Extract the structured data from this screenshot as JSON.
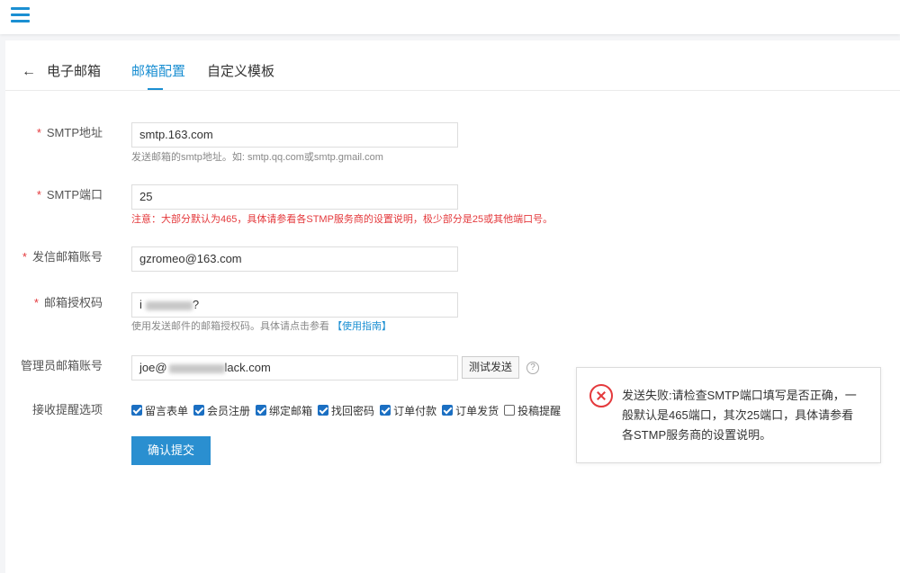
{
  "header": {
    "back_symbol": "←",
    "title": "电子邮箱",
    "tabs": [
      {
        "label": "邮箱配置",
        "active": true
      },
      {
        "label": "自定义模板",
        "active": false
      }
    ]
  },
  "form": {
    "required_mark": "*",
    "smtp_host": {
      "label": "SMTP地址",
      "value": "smtp.163.com",
      "hint": "发送邮箱的smtp地址。如: smtp.qq.com或smtp.gmail.com"
    },
    "smtp_port": {
      "label": "SMTP端口",
      "value": "25",
      "hint": "注意：大部分默认为465，具体请参看各STMP服务商的设置说明，极少部分是25或其他端口号。"
    },
    "sender_account": {
      "label": "发信邮箱账号",
      "value": "gzromeo@163.com"
    },
    "auth_code": {
      "label": "邮箱授权码",
      "value_prefix": "i",
      "value_suffix": "?",
      "hint_prefix": "使用发送邮件的邮箱授权码。具体请点击参看",
      "hint_link": "【使用指南】"
    },
    "admin_account": {
      "label": "管理员邮箱账号",
      "value_prefix": "joe@",
      "value_suffix": "lack.com",
      "test_button": "测试发送",
      "help_symbol": "?"
    },
    "notify": {
      "label": "接收提醒选项",
      "options": [
        {
          "label": "留言表单",
          "checked": true
        },
        {
          "label": "会员注册",
          "checked": true
        },
        {
          "label": "绑定邮箱",
          "checked": true
        },
        {
          "label": "找回密码",
          "checked": true
        },
        {
          "label": "订单付款",
          "checked": true
        },
        {
          "label": "订单发货",
          "checked": true
        },
        {
          "label": "投稿提醒",
          "checked": false
        }
      ]
    },
    "submit_label": "确认提交"
  },
  "toast": {
    "icon": "error-circle-icon",
    "message": "发送失败:请检查SMTP端口填写是否正确，一般默认是465端口，其次25端口，具体请参看各STMP服务商的设置说明。"
  },
  "colors": {
    "accent": "#1b8fd2",
    "error": "#e4393c",
    "submit": "#2a8fd0"
  }
}
